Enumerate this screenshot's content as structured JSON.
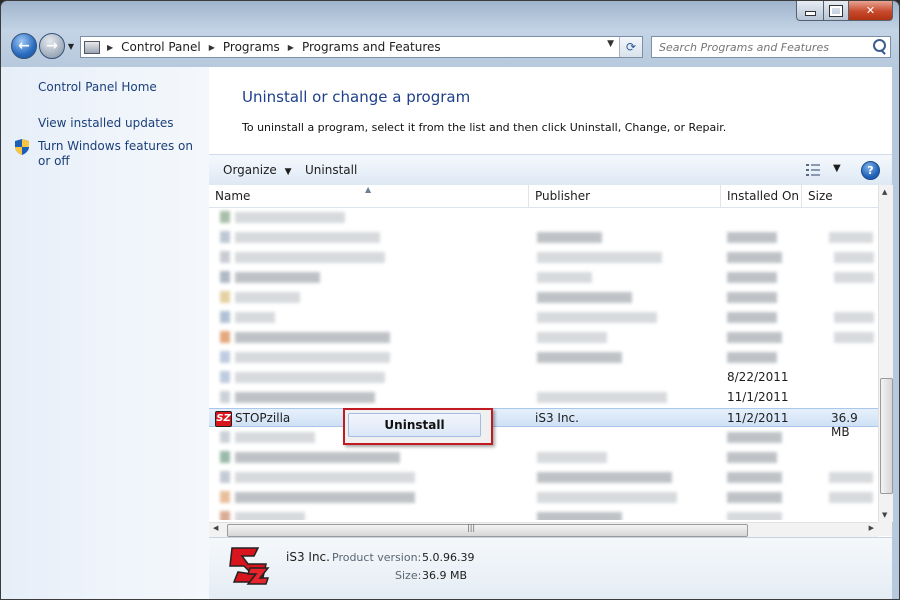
{
  "window": {
    "title_bar_buttons": [
      "minimize",
      "maximize",
      "close"
    ]
  },
  "address_bar": {
    "crumbs": [
      "Control Panel",
      "Programs",
      "Programs and Features"
    ]
  },
  "search": {
    "placeholder": "Search Programs and Features"
  },
  "left_pane": {
    "home": "Control Panel Home",
    "updates": "View installed updates",
    "features": "Turn Windows features on or off"
  },
  "main": {
    "title": "Uninstall or change a program",
    "description": "To uninstall a program, select it from the list and then click Uninstall, Change, or Repair."
  },
  "toolbar": {
    "organize": "Organize",
    "uninstall": "Uninstall",
    "help": "?"
  },
  "columns": {
    "name": "Name",
    "publisher": "Publisher",
    "installed_on": "Installed On",
    "size": "Size"
  },
  "visible_rows": {
    "r10": {
      "installed_on": "8/22/2011"
    },
    "r11": {
      "installed_on": "11/1/2011"
    },
    "selected": {
      "name": "STOPzilla",
      "publisher": "iS3 Inc.",
      "installed_on": "11/2/2011",
      "size": "36.9 MB",
      "icon": "SZ"
    }
  },
  "context_menu": {
    "item": "Uninstall"
  },
  "details": {
    "publisher": "iS3 Inc.",
    "product_version_label": "Product version:",
    "product_version": "5.0.96.39",
    "size_label": "Size:",
    "size": "36.9 MB"
  },
  "colors": {
    "link": "#1a3f7a",
    "title": "#1e3f8c",
    "context_highlight": "#c21a22",
    "logo_red": "#d8141d"
  }
}
